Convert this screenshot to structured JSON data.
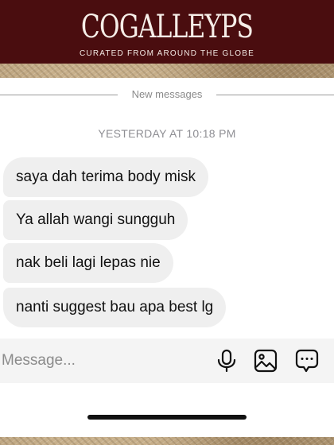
{
  "header": {
    "brand": "COGALLEYPS",
    "tagline": "CURATED FROM AROUND THE GLOBE"
  },
  "chat": {
    "divider_label": "New messages",
    "timestamp": "YESTERDAY AT 10:18 PM",
    "messages": [
      "saya dah terima body misk",
      "Ya allah wangi sungguh",
      "nak beli lagi lepas nie",
      "nanti suggest bau apa best lg"
    ]
  },
  "composer": {
    "placeholder": "Message...",
    "icons": [
      "microphone-icon",
      "gallery-icon",
      "sticker-icon"
    ]
  },
  "colors": {
    "header_bg": "#4a0d0f",
    "bubble_bg": "#efefef",
    "composer_bg": "#f4f4f4"
  }
}
